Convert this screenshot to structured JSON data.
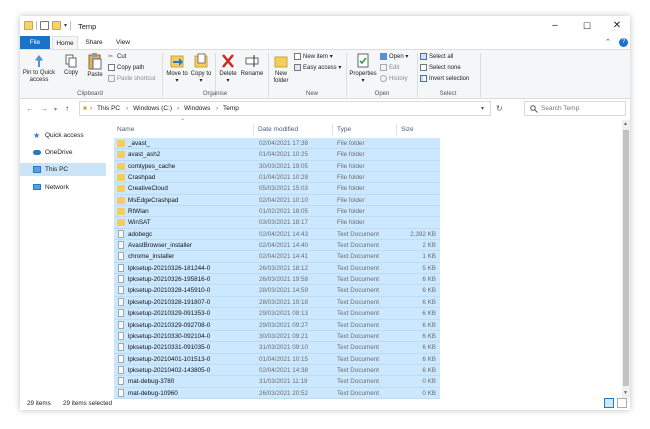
{
  "window": {
    "title": "Temp"
  },
  "tabs": {
    "file": "File",
    "home": "Home",
    "share": "Share",
    "view": "View"
  },
  "ribbon": {
    "clipboard": {
      "pin": "Pin to Quick access",
      "copy": "Copy",
      "paste": "Paste",
      "cut": "Cut",
      "copy_path": "Copy path",
      "paste_shortcut": "Paste shortcut",
      "group": "Clipboard"
    },
    "organise": {
      "move_to": "Move to",
      "copy_to": "Copy to",
      "delete": "Delete",
      "rename": "Rename",
      "group": "Organise"
    },
    "new": {
      "new_folder": "New folder",
      "new_item": "New item",
      "easy_access": "Easy access",
      "group": "New"
    },
    "open": {
      "properties": "Properties",
      "open": "Open",
      "edit": "Edit",
      "history": "History",
      "group": "Open"
    },
    "select": {
      "select_all": "Select all",
      "select_none": "Select none",
      "invert": "Invert selection",
      "group": "Select"
    }
  },
  "address": {
    "crumbs": [
      "This PC",
      "Windows (C:)",
      "Windows",
      "Temp"
    ],
    "search_placeholder": "Search Temp"
  },
  "navpane": [
    {
      "label": "Quick access",
      "icon": "star-icon"
    },
    {
      "label": "OneDrive",
      "icon": "cloud-icon"
    },
    {
      "label": "This PC",
      "icon": "computer-icon"
    },
    {
      "label": "Network",
      "icon": "network-icon"
    }
  ],
  "columns": {
    "name": "Name",
    "date": "Date modified",
    "type": "Type",
    "size": "Size"
  },
  "files": [
    {
      "name": "_avast_",
      "date": "02/04/2021 17:38",
      "type": "File folder",
      "size": "",
      "icon": "folder"
    },
    {
      "name": "avast_ash2",
      "date": "01/04/2021 10:25",
      "type": "File folder",
      "size": "",
      "icon": "folder"
    },
    {
      "name": "comtypes_cache",
      "date": "30/03/2021 19:05",
      "type": "File folder",
      "size": "",
      "icon": "folder"
    },
    {
      "name": "Crashpad",
      "date": "01/04/2021 10:29",
      "type": "File folder",
      "size": "",
      "icon": "folder"
    },
    {
      "name": "CreativeCloud",
      "date": "05/03/2021 15:03",
      "type": "File folder",
      "size": "",
      "icon": "folder"
    },
    {
      "name": "MsEdgeCrashpad",
      "date": "02/04/2021 10:10",
      "type": "File folder",
      "size": "",
      "icon": "folder"
    },
    {
      "name": "RtWlan",
      "date": "01/02/2021 18:05",
      "type": "File folder",
      "size": "",
      "icon": "folder"
    },
    {
      "name": "WinSAT",
      "date": "03/03/2021 18:17",
      "type": "File folder",
      "size": "",
      "icon": "folder"
    },
    {
      "name": "adobegc",
      "date": "02/04/2021 14:43",
      "type": "Text Document",
      "size": "2,392 KB",
      "icon": "doc"
    },
    {
      "name": "AvastBrowser_installer",
      "date": "02/04/2021 14:40",
      "type": "Text Document",
      "size": "2 KB",
      "icon": "doc"
    },
    {
      "name": "chrome_installer",
      "date": "02/04/2021 14:41",
      "type": "Text Document",
      "size": "1 KB",
      "icon": "doc"
    },
    {
      "name": "lpksetup-20210326-181244-0",
      "date": "26/03/2021 18:12",
      "type": "Text Document",
      "size": "5 KB",
      "icon": "doc"
    },
    {
      "name": "lpksetup-20210326-195816-0",
      "date": "26/03/2021 19:58",
      "type": "Text Document",
      "size": "6 KB",
      "icon": "doc"
    },
    {
      "name": "lpksetup-20210328-145910-0",
      "date": "28/03/2021 14:59",
      "type": "Text Document",
      "size": "6 KB",
      "icon": "doc"
    },
    {
      "name": "lpksetup-20210328-191807-0",
      "date": "28/03/2021 19:18",
      "type": "Text Document",
      "size": "6 KB",
      "icon": "doc"
    },
    {
      "name": "lpksetup-20210329-091353-0",
      "date": "29/03/2021 09:13",
      "type": "Text Document",
      "size": "6 KB",
      "icon": "doc"
    },
    {
      "name": "lpksetup-20210329-092708-0",
      "date": "29/03/2021 09:27",
      "type": "Text Document",
      "size": "6 KB",
      "icon": "doc"
    },
    {
      "name": "lpksetup-20210330-092104-0",
      "date": "30/03/2021 09:21",
      "type": "Text Document",
      "size": "6 KB",
      "icon": "doc"
    },
    {
      "name": "lpksetup-20210331-091035-0",
      "date": "31/03/2021 09:10",
      "type": "Text Document",
      "size": "6 KB",
      "icon": "doc"
    },
    {
      "name": "lpksetup-20210401-101513-0",
      "date": "01/04/2021 10:15",
      "type": "Text Document",
      "size": "6 KB",
      "icon": "doc"
    },
    {
      "name": "lpksetup-20210402-143805-0",
      "date": "02/04/2021 14:38",
      "type": "Text Document",
      "size": "6 KB",
      "icon": "doc"
    },
    {
      "name": "mat-debug-3780",
      "date": "31/03/2021 11:19",
      "type": "Text Document",
      "size": "0 KB",
      "icon": "doc"
    },
    {
      "name": "mat-debug-10960",
      "date": "26/03/2021 20:52",
      "type": "Text Document",
      "size": "0 KB",
      "icon": "doc"
    }
  ],
  "status": {
    "count": "29 items",
    "selected": "29 items selected"
  },
  "colors": {
    "accent": "#1a73c8",
    "selection": "#cce8ff",
    "nav_selected": "#cce4f7"
  }
}
